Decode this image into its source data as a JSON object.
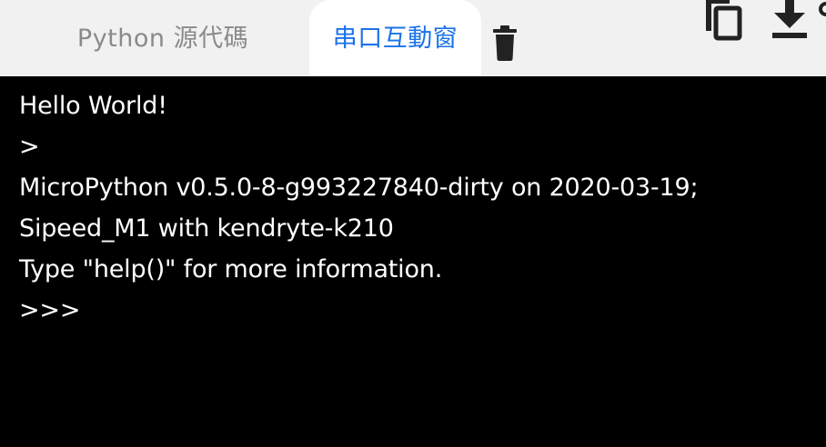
{
  "tabs": [
    {
      "label": "Python 源代碼",
      "active": false
    },
    {
      "label": "串口互動窗",
      "active": true
    }
  ],
  "toolbar": {
    "clear_icon": "trash-icon",
    "copy_icon": "copy-icon",
    "download_icon": "download-icon"
  },
  "colors": {
    "tabbar_bg": "#f1f1f1",
    "active_tab_bg": "#ffffff",
    "active_tab_text": "#1a73e8",
    "inactive_tab_text": "#8a8a8a",
    "console_bg": "#000000",
    "console_text": "#ffffff"
  },
  "console": {
    "lines": [
      "Hello World!",
      ">",
      "MicroPython v0.5.0-8-g993227840-dirty on 2020-03-19;",
      "Sipeed_M1 with kendryte-k210",
      "Type \"help()\" for more information.",
      ">>>"
    ]
  }
}
